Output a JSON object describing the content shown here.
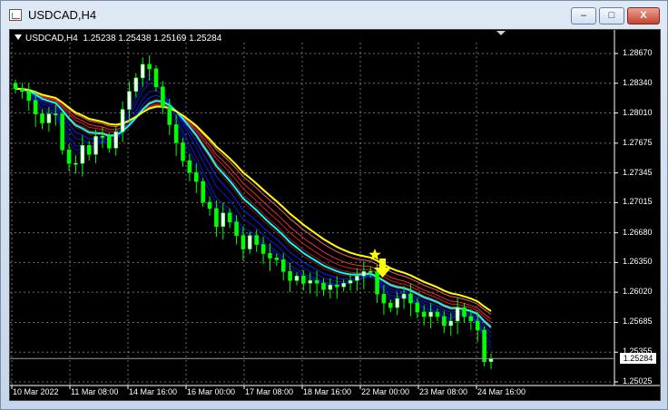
{
  "window": {
    "title": "USDCAD,H4",
    "buttons": {
      "minimize": "–",
      "maximize": "□",
      "close": "X"
    }
  },
  "chart": {
    "info": {
      "symbol": "USDCAD,H4",
      "ohlc": "1.25238 1.25438 1.25169 1.25284"
    },
    "price_axis": [
      "1.28670",
      "1.28340",
      "1.28010",
      "1.27675",
      "1.27345",
      "1.27015",
      "1.26680",
      "1.26350",
      "1.26020",
      "1.25685",
      "1.25355",
      "1.25025"
    ],
    "last_price": "1.25284",
    "time_axis": [
      "10 Mar 2022",
      "11 Mar 08:00",
      "14 Mar 16:00",
      "16 Mar 00:00",
      "17 Mar 08:00",
      "18 Mar 16:00",
      "22 Mar 00:00",
      "23 Mar 08:00",
      "24 Mar 16:00"
    ],
    "colors": {
      "background": "#000000",
      "bull_candle": "#ffffff",
      "bear_candle": "#00ff00",
      "ma_fast": "#0000ff",
      "ma_slow": "#ff0000",
      "ma_signal": "#00ffff",
      "ma_trend": "#ffff00",
      "signal_marker": "#ffff00"
    },
    "markers": {
      "star": "star-icon",
      "arrow": "arrow-down-icon"
    }
  },
  "chart_data": {
    "type": "candlestick",
    "symbol": "USDCAD",
    "timeframe": "H4",
    "ylim": [
      1.25,
      1.2885
    ],
    "close": [
      1.2828,
      1.2825,
      1.2815,
      1.28,
      1.279,
      1.28,
      1.28,
      1.276,
      1.2745,
      1.2745,
      1.2765,
      1.2755,
      1.2775,
      1.2775,
      1.2762,
      1.278,
      1.2805,
      1.2825,
      1.284,
      1.2855,
      1.285,
      1.283,
      1.2808,
      1.2788,
      1.2768,
      1.2748,
      1.2735,
      1.2725,
      1.2702,
      1.2695,
      1.2675,
      1.269,
      1.268,
      1.2665,
      1.265,
      1.2665,
      1.2655,
      1.2645,
      1.264,
      1.2638,
      1.2625,
      1.2615,
      1.262,
      1.2612,
      1.2615,
      1.2612,
      1.2605,
      1.261,
      1.2608,
      1.2612,
      1.2615,
      1.262,
      1.2625,
      1.2625,
      1.26,
      1.259,
      1.2585,
      1.2595,
      1.26,
      1.259,
      1.258,
      1.2575,
      1.258,
      1.2575,
      1.2565,
      1.257,
      1.2585,
      1.2575,
      1.257,
      1.256,
      1.2525,
      1.2528
    ]
  }
}
